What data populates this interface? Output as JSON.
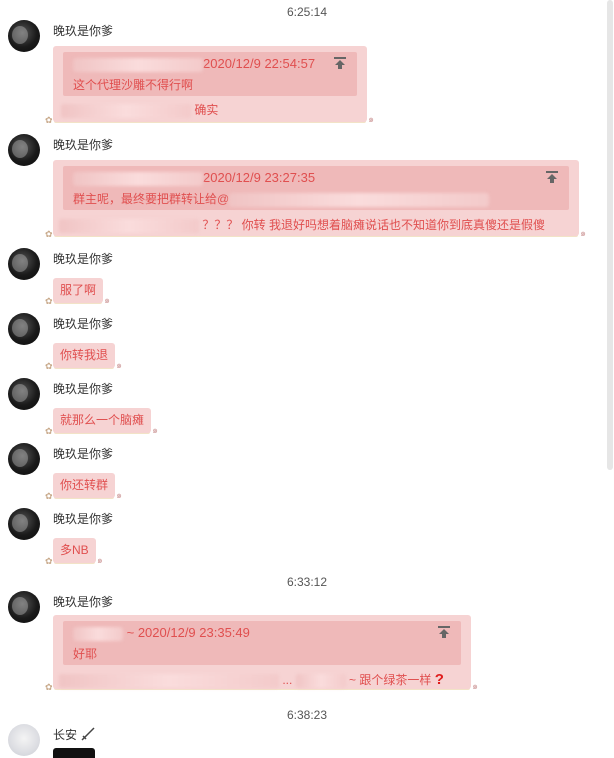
{
  "times": [
    "6:25:14",
    "6:33:12",
    "6:38:23"
  ],
  "messages": [
    {
      "sender": "晚玖是你爹",
      "quote_time": "2020/12/9 22:54:57",
      "quote_text": "这个代理沙雕不得行啊",
      "reply": "确实"
    },
    {
      "sender": "晚玖是你爹",
      "quote_time": "2020/12/9 23:27:35",
      "quote_text": "群主呢，最终要把群转让给@",
      "reply": "？？？ 你转 我退好吗想着脑瘫说话也不知道你到底真傻还是假傻"
    },
    {
      "sender": "晚玖是你爹",
      "text": "服了啊"
    },
    {
      "sender": "晚玖是你爹",
      "text": "你转我退"
    },
    {
      "sender": "晚玖是你爹",
      "text": "就那么一个脑瘫"
    },
    {
      "sender": "晚玖是你爹",
      "text": "你还转群"
    },
    {
      "sender": "晚玖是你爹",
      "text": "多NB"
    },
    {
      "sender": "晚玖是你爹",
      "quote_time": "~ 2020/12/9 23:35:49",
      "quote_text": "好耶",
      "reply_ellipsis": "...",
      "reply": "~ 跟个绿茶一样"
    },
    {
      "sender": "长安"
    }
  ],
  "icons": {
    "pin": "jump-to-original-icon",
    "question": "red-question-mark-icon",
    "sword": "sword-icon"
  },
  "colors": {
    "bubble": "#f6d3d3",
    "quote": "#efb9b9",
    "text": "#e04f4f"
  }
}
